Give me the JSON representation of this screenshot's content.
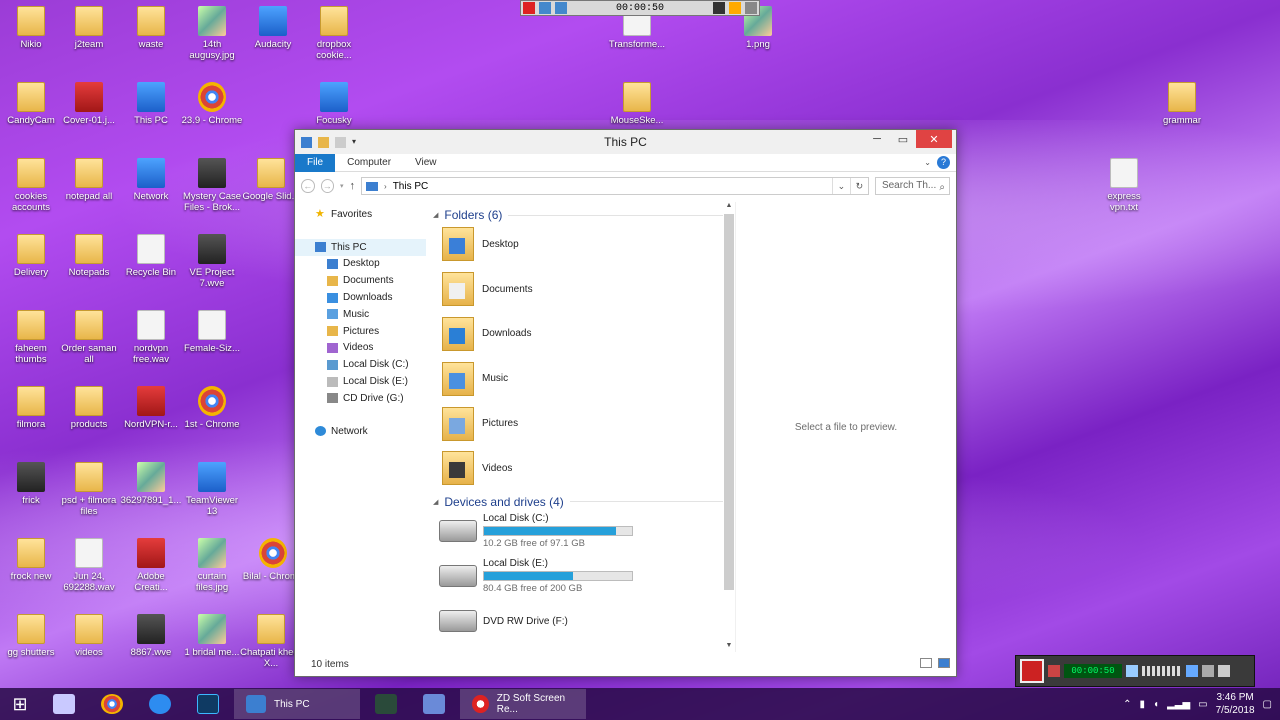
{
  "desktop": {
    "icons": [
      {
        "label": "Nikio"
      },
      {
        "label": "j2team"
      },
      {
        "label": "waste"
      },
      {
        "label": "14th augusy.jpg"
      },
      {
        "label": "Audacity"
      },
      {
        "label": "dropbox cookie..."
      },
      {
        "label": "CandyCam"
      },
      {
        "label": "Cover-01.j..."
      },
      {
        "label": "This PC"
      },
      {
        "label": "23.9 - Chrome"
      },
      {
        "label": "Focusky"
      },
      {
        "label": "cookies accounts"
      },
      {
        "label": "notepad all"
      },
      {
        "label": "Network"
      },
      {
        "label": "Mystery Case Files - Brok..."
      },
      {
        "label": "Google Slid..."
      },
      {
        "label": "Delivery"
      },
      {
        "label": "Notepads"
      },
      {
        "label": "Recycle Bin"
      },
      {
        "label": "VE Project 7.wve"
      },
      {
        "label": "faheem thumbs"
      },
      {
        "label": "Order saman all"
      },
      {
        "label": "nordvpn free.wav"
      },
      {
        "label": "Female-Siz..."
      },
      {
        "label": "filmora"
      },
      {
        "label": "products"
      },
      {
        "label": "NordVPN-r..."
      },
      {
        "label": "1st - Chrome"
      },
      {
        "label": "frick"
      },
      {
        "label": "psd + filmora files"
      },
      {
        "label": "36297891_1..."
      },
      {
        "label": "TeamViewer 13"
      },
      {
        "label": "frock new"
      },
      {
        "label": "Jun 24, 692288.wav"
      },
      {
        "label": "Adobe Creati..."
      },
      {
        "label": "curtain files.jpg"
      },
      {
        "label": "Bilal - Chrome"
      },
      {
        "label": "gg shutters"
      },
      {
        "label": "videos"
      },
      {
        "label": "8867.wve"
      },
      {
        "label": "1 bridal me..."
      },
      {
        "label": "Chatpati kheer X..."
      },
      {
        "label": "Transforme..."
      },
      {
        "label": "1.png"
      },
      {
        "label": "MouseSke..."
      },
      {
        "label": "grammar"
      },
      {
        "label": "express vpn.txt"
      }
    ]
  },
  "recorder_top": {
    "time": "00:00:50"
  },
  "window": {
    "title": "This PC",
    "ribbon_tabs": [
      "File",
      "Computer",
      "View"
    ],
    "address": {
      "location": "This PC",
      "search_placeholder": "Search Th..."
    },
    "nav": {
      "favorites": "Favorites",
      "this_pc": "This PC",
      "children": [
        "Desktop",
        "Documents",
        "Downloads",
        "Music",
        "Pictures",
        "Videos",
        "Local Disk (C:)",
        "Local Disk (E:)",
        "CD Drive (G:)"
      ],
      "network": "Network"
    },
    "folders_header": "Folders (6)",
    "folders": [
      "Desktop",
      "Documents",
      "Downloads",
      "Music",
      "Pictures",
      "Videos"
    ],
    "drives_header": "Devices and drives (4)",
    "drives": [
      {
        "name": "Local Disk (C:)",
        "free": "10.2 GB free of 97.1 GB",
        "used_fraction": 0.895
      },
      {
        "name": "Local Disk (E:)",
        "free": "80.4 GB free of 200 GB",
        "used_fraction": 0.598
      },
      {
        "name": "DVD RW Drive (F:)",
        "free": "",
        "used_fraction": null
      }
    ],
    "preview_text": "Select a file to preview.",
    "status": "10 items"
  },
  "taskbar": {
    "tasks": [
      "This PC",
      "ZD Soft Screen Re..."
    ],
    "time": "3:46 PM",
    "date": "7/5/2018"
  },
  "recorder_panel": {
    "lcd": "00:00:50"
  },
  "colors": {
    "accent": "#1979ca",
    "drive_bar": "#26a0da",
    "close": "#e04343"
  }
}
